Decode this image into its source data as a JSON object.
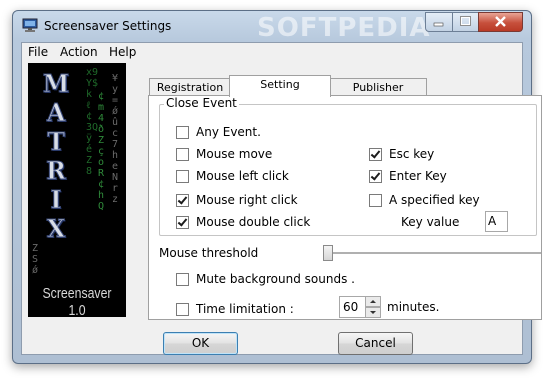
{
  "window": {
    "title": "Screensaver Settings",
    "watermark": "SOFTPEDIA",
    "controls": {
      "minimize": "minimize",
      "maximize": "maximize",
      "close": "close"
    }
  },
  "menu": [
    "File",
    "Action",
    "Help"
  ],
  "sidebar": {
    "letters": [
      "M",
      "A",
      "T",
      "R",
      "I",
      "X"
    ],
    "caption": "Screensaver 1.0"
  },
  "tabs": [
    {
      "label": "Registration",
      "active": false
    },
    {
      "label": "Setting",
      "active": true
    },
    {
      "label": "Publisher",
      "active": false
    }
  ],
  "close_event": {
    "label": "Close Event",
    "options": [
      {
        "label": "Any Event.",
        "checked": false
      },
      {
        "label": "Mouse move",
        "checked": false
      },
      {
        "label": "Mouse left click",
        "checked": false
      },
      {
        "label": "Mouse right click",
        "checked": true
      },
      {
        "label": "Mouse double click",
        "checked": true
      },
      {
        "label": "Esc key",
        "checked": true
      },
      {
        "label": "Enter Key",
        "checked": true
      },
      {
        "label": "A specified key",
        "checked": false
      }
    ],
    "key_value_label": "Key value",
    "key_value": "A"
  },
  "mouse_threshold": {
    "label": "Mouse threshold",
    "value_fraction": 0.0
  },
  "mute": {
    "label": "Mute background sounds .",
    "checked": false
  },
  "time_limit": {
    "label": "Time limitation :",
    "checked": false,
    "value": "60",
    "unit": "minutes."
  },
  "buttons": {
    "ok": "OK",
    "cancel": "Cancel"
  }
}
